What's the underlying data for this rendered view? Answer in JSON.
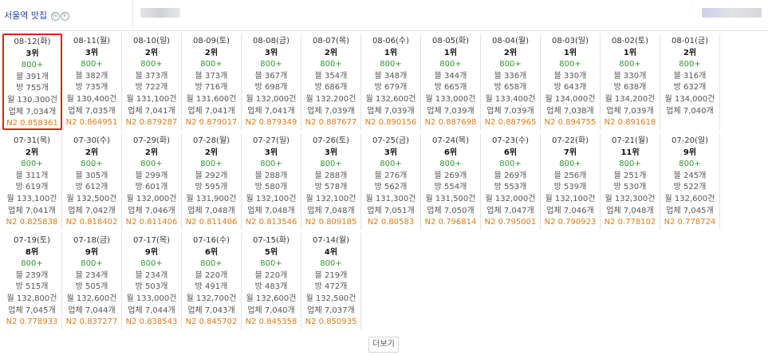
{
  "header": {
    "keyword": "서울역 맛집",
    "icons": [
      "ⓜ",
      "ⓟ"
    ]
  },
  "more_label": "더보기",
  "highlight_color": "#e0201a",
  "rows": [
    [
      {
        "date": "08-12(화)",
        "rank": "3위",
        "vol": "800+",
        "blog": "블 391개",
        "cafe": "방 755개",
        "monthly": "월 130,300건",
        "biz": "업체 7,034개",
        "n2": "N2 0.858361"
      },
      {
        "date": "08-11(월)",
        "rank": "3위",
        "vol": "800+",
        "blog": "블 382개",
        "cafe": "방 735개",
        "monthly": "월 130,400건",
        "biz": "업체 7,035개",
        "n2": "N2 0.864951"
      },
      {
        "date": "08-10(일)",
        "rank": "2위",
        "vol": "800+",
        "blog": "블 373개",
        "cafe": "방 722개",
        "monthly": "월 131,100건",
        "biz": "업체 7,041개",
        "n2": "N2 0.879287"
      },
      {
        "date": "08-09(토)",
        "rank": "2위",
        "vol": "800+",
        "blog": "블 373개",
        "cafe": "방 716개",
        "monthly": "월 131,600건",
        "biz": "업체 7,041개",
        "n2": "N2 0.879017"
      },
      {
        "date": "08-08(금)",
        "rank": "3위",
        "vol": "800+",
        "blog": "블 367개",
        "cafe": "방 698개",
        "monthly": "월 132,000건",
        "biz": "업체 7,041개",
        "n2": "N2 0.879349"
      },
      {
        "date": "08-07(목)",
        "rank": "2위",
        "vol": "800+",
        "blog": "블 354개",
        "cafe": "방 686개",
        "monthly": "월 132,200건",
        "biz": "업체 7,039개",
        "n2": "N2 0.887677"
      },
      {
        "date": "08-06(수)",
        "rank": "1위",
        "vol": "800+",
        "blog": "블 348개",
        "cafe": "방 679개",
        "monthly": "월 132,600건",
        "biz": "업체 7,039개",
        "n2": "N2 0.890156"
      },
      {
        "date": "08-05(화)",
        "rank": "1위",
        "vol": "800+",
        "blog": "블 344개",
        "cafe": "방 665개",
        "monthly": "월 133,000건",
        "biz": "업체 7,039개",
        "n2": "N2 0.887698"
      },
      {
        "date": "08-04(월)",
        "rank": "2위",
        "vol": "800+",
        "blog": "블 336개",
        "cafe": "방 658개",
        "monthly": "월 133,400건",
        "biz": "업체 7,039개",
        "n2": "N2 0.887965"
      },
      {
        "date": "08-03(일)",
        "rank": "1위",
        "vol": "800+",
        "blog": "블 330개",
        "cafe": "방 643개",
        "monthly": "월 134,000건",
        "biz": "업체 7,038개",
        "n2": "N2 0.894755"
      },
      {
        "date": "08-02(토)",
        "rank": "1위",
        "vol": "800+",
        "blog": "블 330개",
        "cafe": "방 638개",
        "monthly": "월 134,200건",
        "biz": "업체 7,039개",
        "n2": "N2 0.891618"
      },
      {
        "date": "08-01(금)",
        "rank": "2위",
        "vol": "800+",
        "blog": "블 316개",
        "cafe": "방 632개",
        "monthly": "월 134,000건",
        "biz": "업체 7,040개",
        "n2": ""
      }
    ],
    [
      {
        "date": "07-31(목)",
        "rank": "2위",
        "vol": "800+",
        "blog": "블 311개",
        "cafe": "방 619개",
        "monthly": "월 133,100건",
        "biz": "업체 7,041개",
        "n2": "N2 0.825838"
      },
      {
        "date": "07-30(수)",
        "rank": "2위",
        "vol": "800+",
        "blog": "블 305개",
        "cafe": "방 612개",
        "monthly": "월 132,500건",
        "biz": "업체 7,042개",
        "n2": "N2 0.818402"
      },
      {
        "date": "07-29(화)",
        "rank": "2위",
        "vol": "800+",
        "blog": "블 299개",
        "cafe": "방 601개",
        "monthly": "월 132,000건",
        "biz": "업체 7,046개",
        "n2": "N2 0.811406"
      },
      {
        "date": "07-28(월)",
        "rank": "2위",
        "vol": "800+",
        "blog": "블 292개",
        "cafe": "방 595개",
        "monthly": "월 131,900건",
        "biz": "업체 7,048개",
        "n2": "N2 0.811406"
      },
      {
        "date": "07-27(일)",
        "rank": "3위",
        "vol": "800+",
        "blog": "블 288개",
        "cafe": "방 580개",
        "monthly": "월 132,100건",
        "biz": "업체 7,048개",
        "n2": "N2 0.813546"
      },
      {
        "date": "07-26(토)",
        "rank": "3위",
        "vol": "800+",
        "blog": "블 288개",
        "cafe": "방 578개",
        "monthly": "월 132,100건",
        "biz": "업체 7,048개",
        "n2": "N2 0.809185"
      },
      {
        "date": "07-25(금)",
        "rank": "3위",
        "vol": "800+",
        "blog": "블 276개",
        "cafe": "방 562개",
        "monthly": "월 131,300건",
        "biz": "업체 7,051개",
        "n2": "N2 0.80583"
      },
      {
        "date": "07-24(목)",
        "rank": "6위",
        "vol": "800+",
        "blog": "블 269개",
        "cafe": "방 554개",
        "monthly": "월 131,500건",
        "biz": "업체 7,050개",
        "n2": "N2 0.796814"
      },
      {
        "date": "07-23(수)",
        "rank": "6위",
        "vol": "800+",
        "blog": "블 269개",
        "cafe": "방 553개",
        "monthly": "월 132,000건",
        "biz": "업체 7,047개",
        "n2": "N2 0.795001"
      },
      {
        "date": "07-22(화)",
        "rank": "7위",
        "vol": "800+",
        "blog": "블 256개",
        "cafe": "방 539개",
        "monthly": "월 132,100건",
        "biz": "업체 7,046개",
        "n2": "N2 0.790923"
      },
      {
        "date": "07-21(월)",
        "rank": "11위",
        "vol": "800+",
        "blog": "블 251개",
        "cafe": "방 530개",
        "monthly": "월 132,300건",
        "biz": "업체 7,048개",
        "n2": "N2 0.778102"
      },
      {
        "date": "07-20(일)",
        "rank": "9위",
        "vol": "800+",
        "blog": "블 245개",
        "cafe": "방 522개",
        "monthly": "월 132,600건",
        "biz": "업체 7,045개",
        "n2": "N2 0.778724"
      }
    ],
    [
      {
        "date": "07-19(토)",
        "rank": "8위",
        "vol": "800+",
        "blog": "블 239개",
        "cafe": "방 515개",
        "monthly": "월 132,800건",
        "biz": "업체 7,045개",
        "n2": "N2 0.778933"
      },
      {
        "date": "07-18(금)",
        "rank": "9위",
        "vol": "800+",
        "blog": "블 234개",
        "cafe": "방 505개",
        "monthly": "월 132,600건",
        "biz": "업체 7,044개",
        "n2": "N2 0.837277"
      },
      {
        "date": "07-17(목)",
        "rank": "9위",
        "vol": "800+",
        "blog": "블 234개",
        "cafe": "방 503개",
        "monthly": "월 133,000건",
        "biz": "업체 7,044개",
        "n2": "N2 0.838543"
      },
      {
        "date": "07-16(수)",
        "rank": "6위",
        "vol": "800+",
        "blog": "블 220개",
        "cafe": "방 491개",
        "monthly": "월 132,700건",
        "biz": "업체 7,043개",
        "n2": "N2 0.845702"
      },
      {
        "date": "07-15(화)",
        "rank": "5위",
        "vol": "800+",
        "blog": "블 220개",
        "cafe": "방 483개",
        "monthly": "월 132,600건",
        "biz": "업체 7,040개",
        "n2": "N2 0.845358"
      },
      {
        "date": "07-14(월)",
        "rank": "4위",
        "vol": "800+",
        "blog": "블 219개",
        "cafe": "방 472개",
        "monthly": "월 132,500건",
        "biz": "업체 7,037개",
        "n2": "N2 0.850935"
      }
    ]
  ]
}
